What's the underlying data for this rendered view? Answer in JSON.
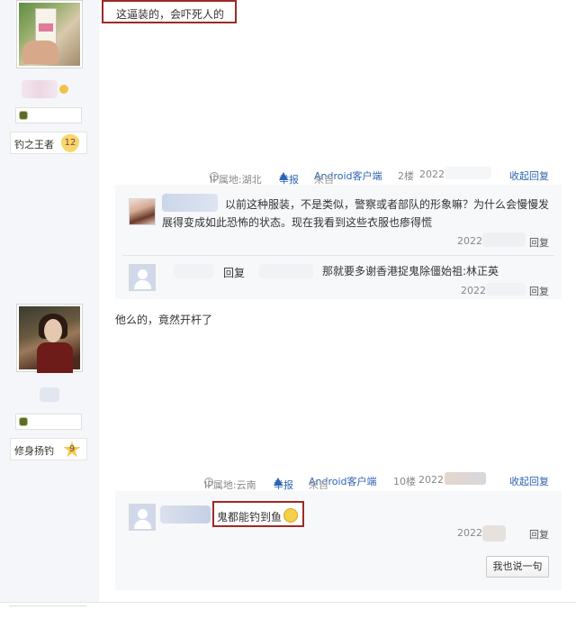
{
  "post1": {
    "quote_text": "这逼装的，会吓死人的",
    "user_badge": "钓之王者",
    "badge_level": "12"
  },
  "reply_meta_1": {
    "ip": "IP属地:湖北",
    "report": "举报",
    "client_prefix": "来自",
    "client": "Android客户端",
    "floor": "2楼",
    "date": "2022",
    "collapse": "收起回复"
  },
  "comments_1": [
    {
      "text": "以前这种服装，不是类似，警察或者部队的形象嘛？为什么会慢慢发展得变成如此恐怖的状态。现在我看到这些衣服也瘆得慌",
      "date": "2022",
      "reply": "回复"
    },
    {
      "reply_label": "回复",
      "text": "那就要多谢香港捉鬼除僵始祖:林正英",
      "date": "2022",
      "reply": "回复"
    }
  ],
  "post2": {
    "text": "他么的，竟然开杆了",
    "user_badge": "修身扬钓",
    "badge_level": "9"
  },
  "reply_meta_2": {
    "ip": "IP属地:云南",
    "report": "举报",
    "client_prefix": "来自",
    "client": "Android客户端",
    "floor": "10楼",
    "date": "2022",
    "collapse": "收起回复"
  },
  "comments_2": [
    {
      "text": "鬼都能钓到鱼",
      "date": "2022",
      "reply": "回复"
    }
  ],
  "say_one_button": "我也说一句",
  "colors": {
    "link": "#2d64b3",
    "highlight_border": "#9b2b26",
    "sidebar_bg": "#f4f6f9",
    "comment_bg": "#f7f8fa"
  }
}
